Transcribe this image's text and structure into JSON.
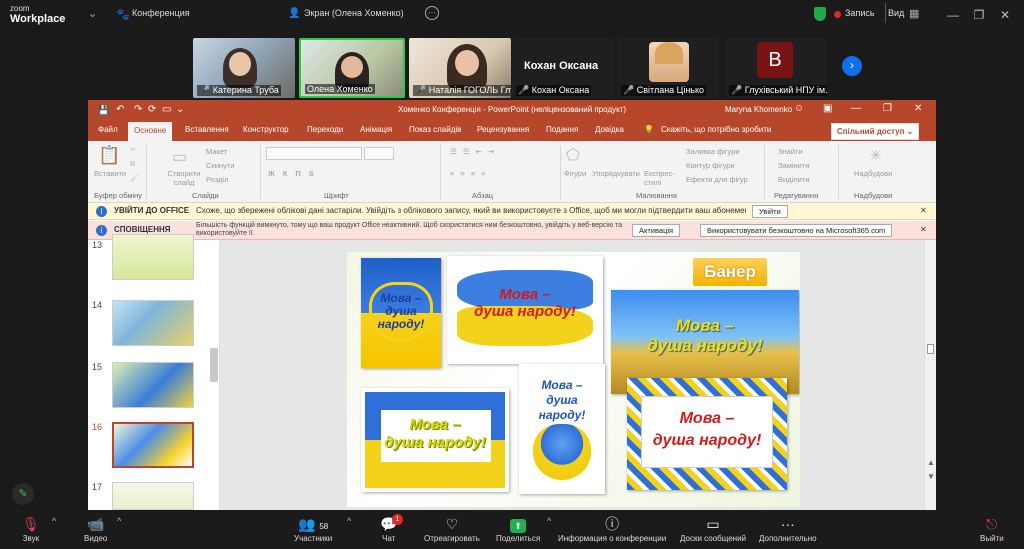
{
  "zoom": {
    "logo_line1": "zoom",
    "logo_line2": "Workplace",
    "tab_conference": "Конференция",
    "screen_title": "Экран (Олена Хоменко)",
    "record_label": "Запись",
    "view_label": "Вид"
  },
  "participants": [
    {
      "name": "Катерина Труба"
    },
    {
      "name": "Олена Хоменко"
    },
    {
      "name": "Наталія ГОГОЛЬ Глухі..."
    },
    {
      "name": "Кохан Оксана"
    },
    {
      "name": "Світлана Цінько"
    },
    {
      "name": "Глухівський НПУ ім. Д..."
    }
  ],
  "speaker_big_name": "Кохан Оксана",
  "avatar_letter": "В",
  "ppt": {
    "title": "Хоменко Конференція - PowerPoint (неліцензований продукт)",
    "user": "Maryna Khomenko",
    "tabs": [
      "Файл",
      "Основне",
      "Вставлення",
      "Конструктор",
      "Переходи",
      "Анімація",
      "Показ слайдів",
      "Рецензування",
      "Подання",
      "Довідка"
    ],
    "tell_me": "Скажіть, що потрібно зробити",
    "share": "Спільний доступ",
    "groups": [
      "Буфер обміну",
      "Слайди",
      "Шрифт",
      "Абзац",
      "Малювання",
      "Редагування",
      "Надбудови"
    ],
    "ribbon_labels": {
      "paste": "Вставити",
      "new_slide": "Створити слайд",
      "layout": "Макет",
      "reset": "Скинути",
      "section": "Розділ",
      "shapes": "Фігури",
      "arrange": "Упорядкувати",
      "quick_styles": "Експрес-стилі",
      "fill": "Заливка фігури",
      "outline": "Контур фігури",
      "effects": "Ефекти для фігур",
      "find": "Знайти",
      "replace": "Замінити",
      "select": "Виділити",
      "addins": "Надбудови"
    },
    "bar1_title": "УВІЙТИ ДО OFFICE",
    "bar1_text": "Схоже, що збережені облікові дані застаріли. Увійдіть з облікового запису, який ви використовуєте з Office, щоб ми могли підтвердити ваш абонемент.",
    "bar1_button": "Увійти",
    "bar2_title": "СПОВІЩЕННЯ",
    "bar2_text": "Більшість функцій вимкнуто, тому що ваш продукт Office неактивний. Щоб скористатися ним безкоштовно, увійдіть у веб-версію та використовуйте її.",
    "bar2_button1": "Активація",
    "bar2_button2": "Використовувати безкоштовно на Microsoft365.com",
    "slide_numbers": [
      "13",
      "14",
      "15",
      "16",
      "17"
    ],
    "slide": {
      "banner": "Банер",
      "mova1": "Мова –",
      "mova2": "душа",
      "mova3": "народу!",
      "mova_full2": "душа народу!"
    }
  },
  "bottom": {
    "sound": "Звук",
    "video": "Видео",
    "participants": "Участники",
    "participants_count": "58",
    "chat": "Чат",
    "chat_badge": "1",
    "react": "Отреагировать",
    "share": "Поделиться",
    "info": "Информация о конференции",
    "whiteboard": "Доски сообщений",
    "more": "Дополнительно",
    "leave": "Выйти"
  }
}
